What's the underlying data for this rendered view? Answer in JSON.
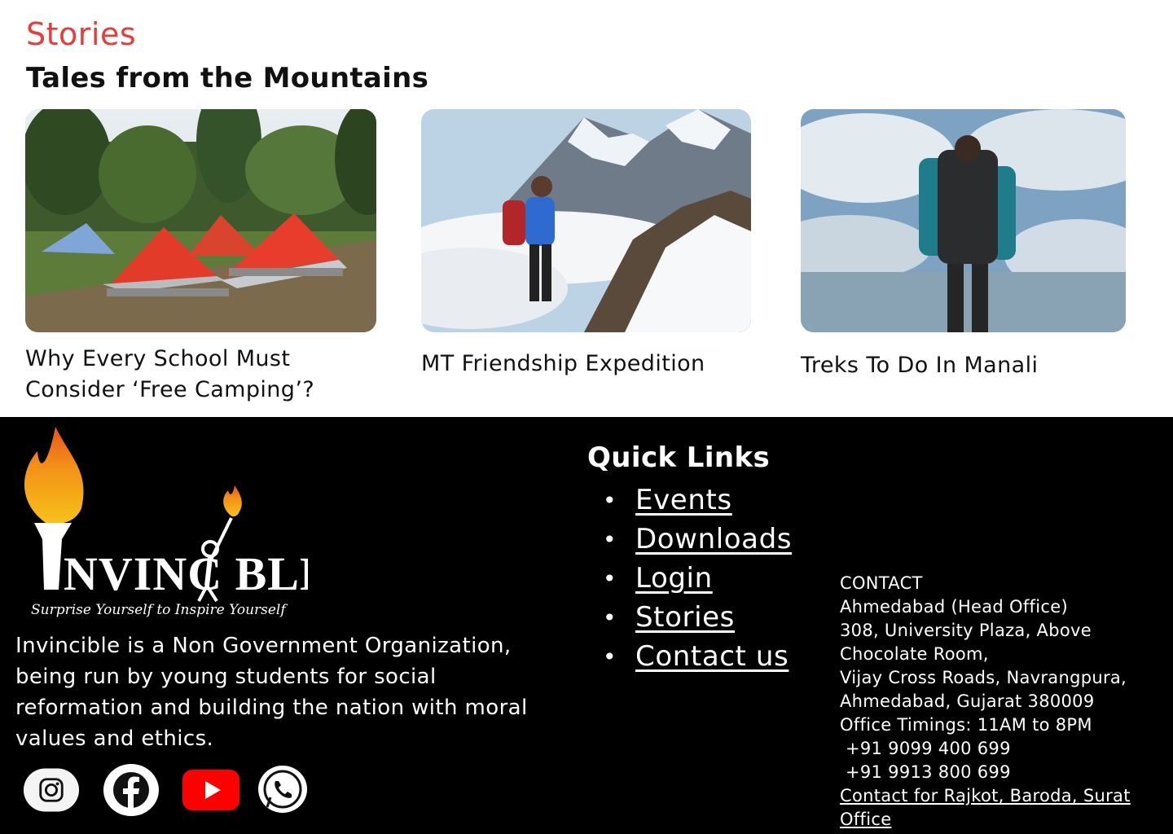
{
  "stories": {
    "kicker": "Stories",
    "heading": "Tales from the Mountains",
    "cards": [
      {
        "title": "Why Every School Must Consider ‘Free Camping’?",
        "image": "camping-tents-photo"
      },
      {
        "title": "MT Friendship Expedition",
        "image": "mountain-hiker-photo"
      },
      {
        "title": "Treks To Do In Manali",
        "image": "backpacker-clouds-photo"
      }
    ]
  },
  "footer": {
    "logo_text": "INVINCIBLE",
    "logo_tagline": "Surprise Yourself to Inspire Yourself",
    "about": "Invincible is a Non Government Organization, being run by young students for social reformation and building the nation with moral values and ethics.",
    "social": [
      "instagram-icon",
      "facebook-icon",
      "youtube-icon",
      "whatsapp-icon"
    ],
    "quick_links_title": "Quick Links",
    "quick_links": [
      "Events",
      "Downloads",
      "Login",
      "Stories",
      "Contact us"
    ],
    "contact": {
      "heading": "CONTACT",
      "office": "Ahmedabad (Head Office)",
      "address_1": "308, University Plaza, Above Chocolate Room,",
      "address_2": "Vijay Cross Roads, Navrangpura, Ahmedabad, Gujarat 380009",
      "timings": "Office Timings: 11AM to 8PM",
      "phone_1": " +91 9099 400 699",
      "phone_2": " +91 9913 800 699",
      "other_offices_link": "Contact for Rajkot, Baroda, Surat Office"
    }
  },
  "colors": {
    "accent": "#ea3b3b",
    "footer_bg": "#000000",
    "youtube": "#ff0000"
  }
}
